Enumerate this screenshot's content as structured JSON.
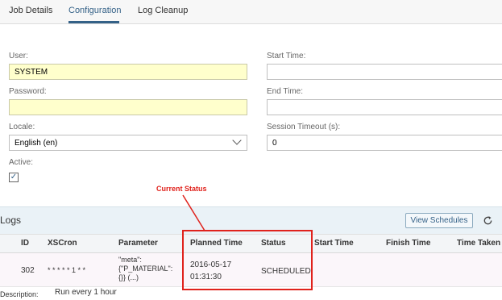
{
  "tabs": [
    {
      "label": "Job Details",
      "active": false
    },
    {
      "label": "Configuration",
      "active": true
    },
    {
      "label": "Log Cleanup",
      "active": false
    }
  ],
  "form": {
    "user_label": "User:",
    "user_value": "SYSTEM",
    "password_label": "Password:",
    "password_value": "",
    "locale_label": "Locale:",
    "locale_value": "English (en)",
    "active_label": "Active:",
    "active_checked": true,
    "checkmark": "✓",
    "start_time_label": "Start Time:",
    "start_time_value": "",
    "end_time_label": "End Time:",
    "end_time_value": "",
    "session_timeout_label": "Session Timeout (s):",
    "session_timeout_value": "0"
  },
  "annotation": {
    "text": "Current Status",
    "color": "#e0221c"
  },
  "logs": {
    "title": "Logs",
    "view_schedules_label": "View Schedules",
    "refresh_icon": "refresh-icon",
    "columns": [
      "ID",
      "XSCron",
      "Parameter",
      "Planned Time",
      "Status",
      "Start Time",
      "Finish Time",
      "Time Taken"
    ],
    "row": {
      "id": "302",
      "xscron": "* * * * * 1 * *",
      "parameter_lines": [
        "\"meta\":",
        "{\"P_MATERIAL\":",
        "{}} (...)"
      ],
      "planned_time_date": "2016-05-17",
      "planned_time_time": "01:31:30",
      "status": "SCHEDULED",
      "start_time": "",
      "finish_time": "",
      "time_taken": ""
    },
    "description_label": "Description:",
    "description_value": "Run every 1 hour"
  },
  "colors": {
    "accent": "#346187",
    "required_field": "#ffffcc",
    "annotation_red": "#e0221c",
    "logs_bar": "#eaf2f7"
  }
}
